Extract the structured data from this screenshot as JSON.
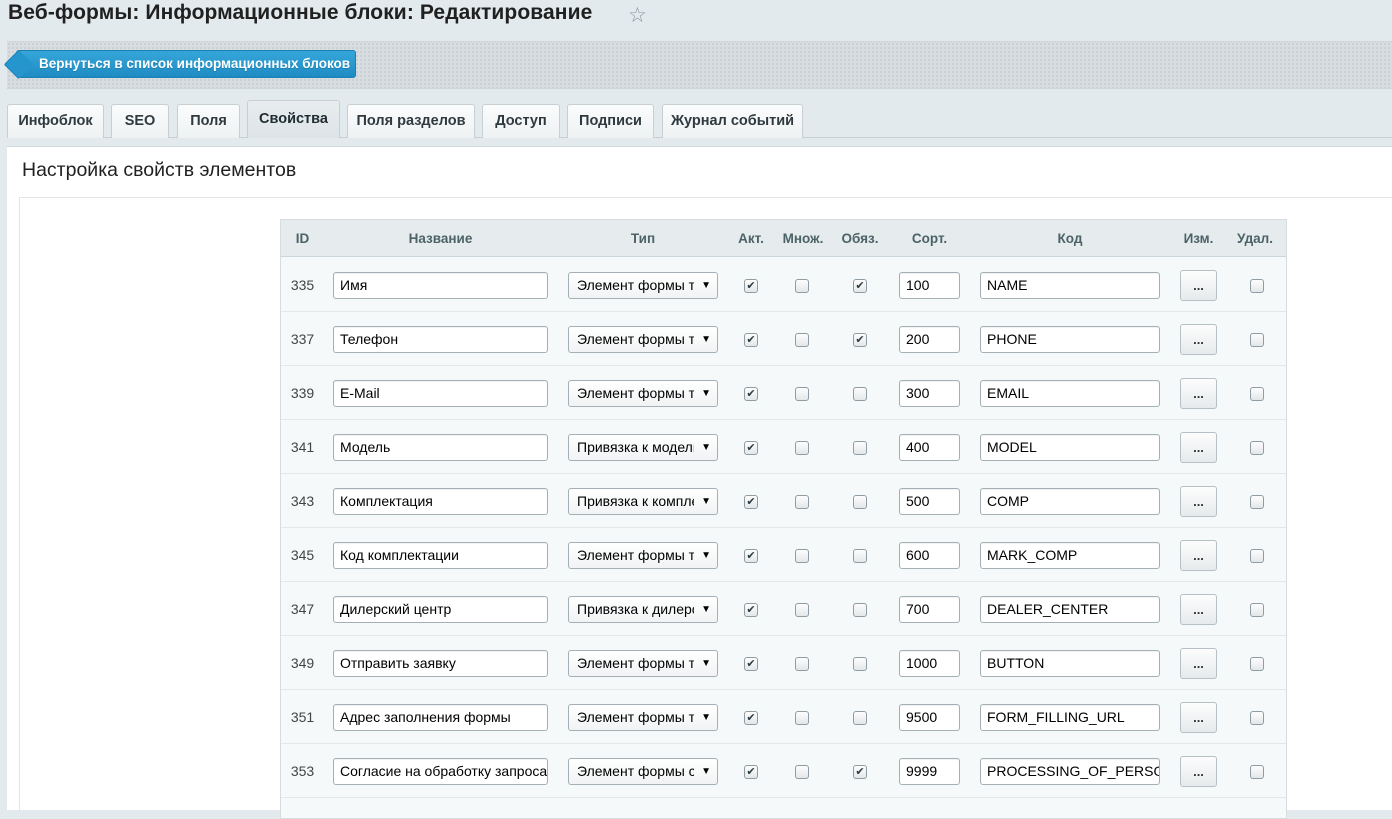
{
  "page": {
    "title": "Веб-формы: Информационные блоки: Редактирование",
    "back_label": "Вернуться в список информационных блоков"
  },
  "tabs": [
    {
      "label": "Инфоблок",
      "active": false
    },
    {
      "label": "SEO",
      "active": false
    },
    {
      "label": "Поля",
      "active": false
    },
    {
      "label": "Свойства",
      "active": true
    },
    {
      "label": "Поля разделов",
      "active": false
    },
    {
      "label": "Доступ",
      "active": false
    },
    {
      "label": "Подписи",
      "active": false
    },
    {
      "label": "Журнал событий",
      "active": false
    }
  ],
  "section": {
    "title": "Настройка свойств элементов"
  },
  "table": {
    "columns": {
      "id": "ID",
      "name": "Название",
      "type": "Тип",
      "active": "Акт.",
      "multiple": "Множ.",
      "required": "Обяз.",
      "sort": "Сорт.",
      "code": "Код",
      "edit": "Изм.",
      "delete": "Удал."
    },
    "edit_button_label": "...",
    "rows": [
      {
        "id": "335",
        "name": "Имя",
        "type": "Элемент формы текст",
        "active": true,
        "multiple": false,
        "required": true,
        "sort": "100",
        "code": "NAME",
        "delete": false
      },
      {
        "id": "337",
        "name": "Телефон",
        "type": "Элемент формы текст",
        "active": true,
        "multiple": false,
        "required": true,
        "sort": "200",
        "code": "PHONE",
        "delete": false
      },
      {
        "id": "339",
        "name": "E-Mail",
        "type": "Элемент формы текст",
        "active": true,
        "multiple": false,
        "required": false,
        "sort": "300",
        "code": "EMAIL",
        "delete": false
      },
      {
        "id": "341",
        "name": "Модель",
        "type": "Привязка к модели",
        "active": true,
        "multiple": false,
        "required": false,
        "sort": "400",
        "code": "MODEL",
        "delete": false
      },
      {
        "id": "343",
        "name": "Комплектация",
        "type": "Привязка к комплектации",
        "active": true,
        "multiple": false,
        "required": false,
        "sort": "500",
        "code": "COMP",
        "delete": false
      },
      {
        "id": "345",
        "name": "Код комплектации",
        "type": "Элемент формы текст",
        "active": true,
        "multiple": false,
        "required": false,
        "sort": "600",
        "code": "MARK_COMP",
        "delete": false
      },
      {
        "id": "347",
        "name": "Дилерский центр",
        "type": "Привязка к дилерскому центру",
        "active": true,
        "multiple": false,
        "required": false,
        "sort": "700",
        "code": "DEALER_CENTER",
        "delete": false
      },
      {
        "id": "349",
        "name": "Отправить заявку",
        "type": "Элемент формы текст",
        "active": true,
        "multiple": false,
        "required": false,
        "sort": "1000",
        "code": "BUTTON",
        "delete": false
      },
      {
        "id": "351",
        "name": "Адрес заполнения формы",
        "type": "Элемент формы текст",
        "active": true,
        "multiple": false,
        "required": false,
        "sort": "9500",
        "code": "FORM_FILLING_URL",
        "delete": false
      },
      {
        "id": "353",
        "name": "Согласие на обработку запроса",
        "type": "Элемент формы список",
        "active": true,
        "multiple": false,
        "required": true,
        "sort": "9999",
        "code": "PROCESSING_OF_PERSONAL_DATA",
        "delete": false
      }
    ]
  }
}
